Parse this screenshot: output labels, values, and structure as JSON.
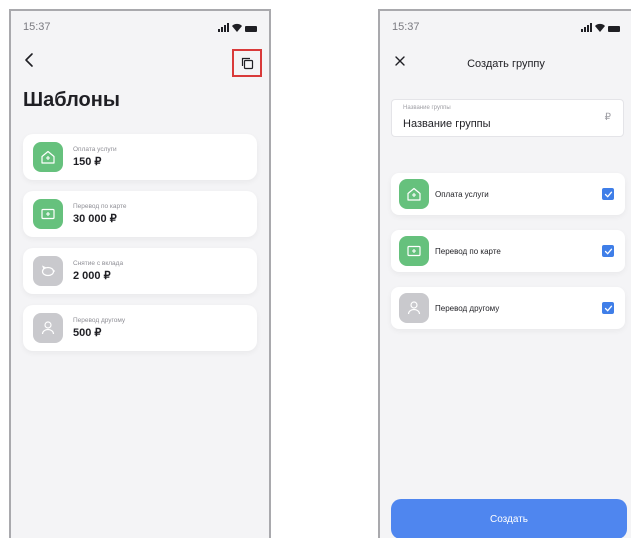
{
  "left_screen": {
    "status_time": "15:37",
    "title": "Шаблоны",
    "templates": [
      {
        "label": "Оплата услуги",
        "amount": "150 ₽",
        "icon": "house-icon",
        "color": "#66c17d"
      },
      {
        "label": "Перевод по карте",
        "amount": "30 000 ₽",
        "icon": "card-transfer-icon",
        "color": "#66c17d"
      },
      {
        "label": "Снятие с вклада",
        "amount": "2 000 ₽",
        "icon": "piggy-bank-icon",
        "color": "#c9c9cd"
      },
      {
        "label": "Перевод другому",
        "amount": "500 ₽",
        "icon": "person-icon",
        "color": "#c9c9cd"
      }
    ]
  },
  "right_screen": {
    "status_time": "15:37",
    "title": "Создать группу",
    "group_field": {
      "label": "Название группы",
      "value": "Название группы",
      "currency": "₽"
    },
    "items": [
      {
        "label": "Оплата услуги",
        "icon": "house-icon",
        "checked": true
      },
      {
        "label": "Перевод по карте",
        "icon": "card-transfer-icon",
        "checked": true
      },
      {
        "label": "Перевод другому",
        "icon": "person-icon",
        "checked": true
      }
    ],
    "create_label": "Создать"
  },
  "colors": {
    "accent": "#4f86ef",
    "checkbox": "#3f7ee8",
    "green": "#66c17d",
    "grey": "#c9c9cd",
    "highlight": "#d93a3a"
  }
}
